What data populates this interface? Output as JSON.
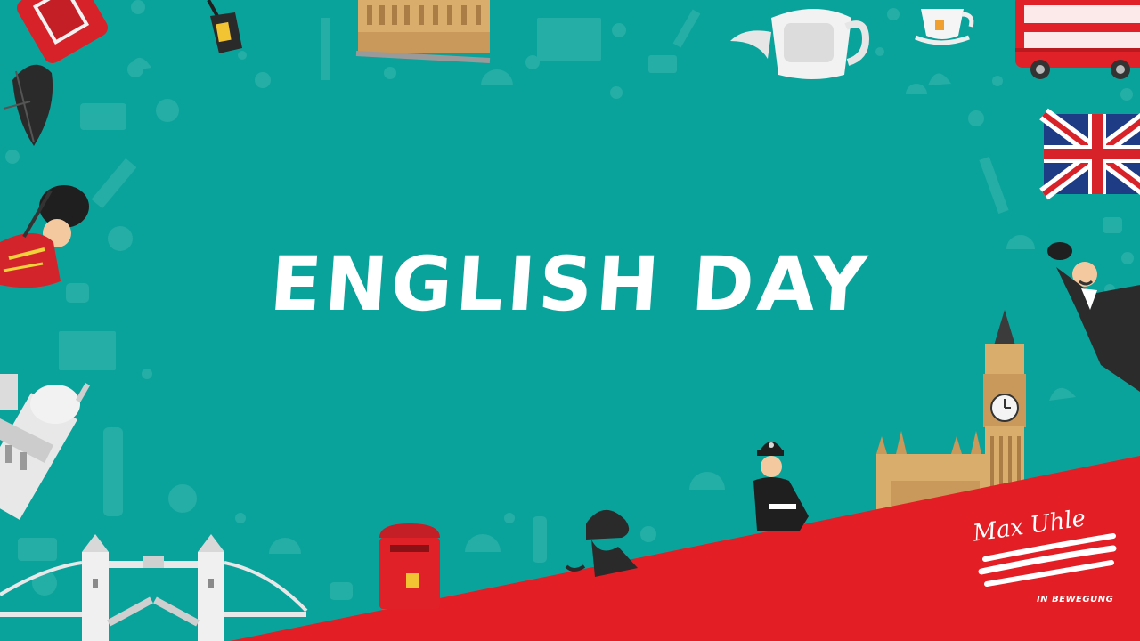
{
  "title": "ENGLISH DAY",
  "brand": {
    "name": "Max Uhle",
    "tagline": "IN BEWEGUNG"
  },
  "colors": {
    "background": "#0aa39b",
    "accent_red": "#e31e24",
    "text": "#ffffff"
  },
  "icons": [
    "phone-box-icon",
    "umbrella-icon",
    "royal-guard-icon",
    "st-pauls-cathedral-icon",
    "tower-bridge-icon",
    "street-lamp-icon",
    "parliament-building-icon",
    "union-jack-icon",
    "teapot-icon",
    "teacup-icon",
    "double-decker-bus-icon",
    "gentleman-bowler-hat-icon",
    "big-ben-icon",
    "police-officer-icon",
    "sherlock-silhouette-icon",
    "post-box-icon"
  ]
}
